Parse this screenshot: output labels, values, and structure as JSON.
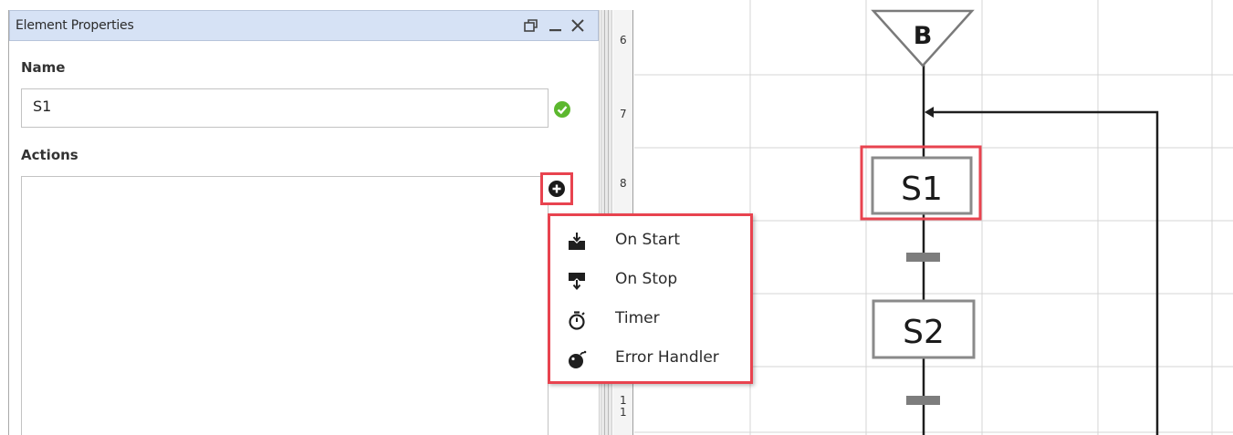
{
  "panel": {
    "title": "Element Properties",
    "name_label": "Name",
    "name_value": "S1",
    "actions_label": "Actions"
  },
  "action_menu": {
    "items": [
      {
        "label": "On Start",
        "icon": "on-start-icon"
      },
      {
        "label": "On Stop",
        "icon": "on-stop-icon"
      },
      {
        "label": "Timer",
        "icon": "timer-icon"
      },
      {
        "label": "Error Handler",
        "icon": "error-handler-icon"
      }
    ]
  },
  "ruler": {
    "rows": [
      "6",
      "7",
      "8",
      "1\n1"
    ]
  },
  "chart": {
    "begin_label": "B",
    "step1_label": "S1",
    "step2_label": "S2"
  },
  "colors": {
    "highlight": "#e8434f",
    "header_bg": "#d6e2f5",
    "valid": "#5cb82e"
  }
}
